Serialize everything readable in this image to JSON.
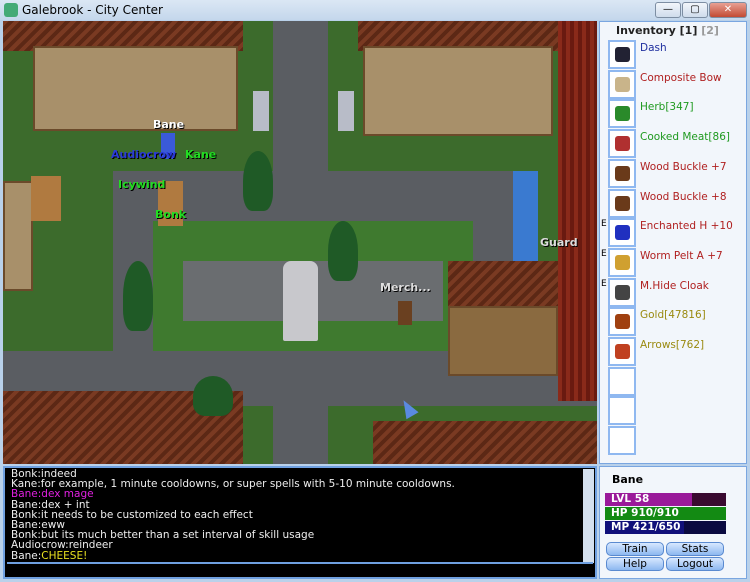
{
  "window": {
    "title": "Galebrook - City Center",
    "minimize": "—",
    "maximize": "▢",
    "close": "✕"
  },
  "map_names": [
    {
      "text": "Bane",
      "color": "#ffffff"
    },
    {
      "text": "Audiocrow",
      "color": "#2a3ad8"
    },
    {
      "text": "Kane",
      "color": "#22dd22"
    },
    {
      "text": "Icywind",
      "color": "#22dd22"
    },
    {
      "text": "Bonk",
      "color": "#22dd22"
    },
    {
      "text": "Merch...",
      "color": "#dddddd"
    },
    {
      "text": "Guard",
      "color": "#dddddd"
    }
  ],
  "inventory": {
    "title": "Inventory",
    "tab1": "[1]",
    "tab2": "[2]",
    "items": [
      {
        "name": "Dash",
        "color": "#1f2f9f",
        "icon": "book-icon",
        "equipped": ""
      },
      {
        "name": "Composite Bow",
        "color": "#b02020",
        "icon": "bow-icon",
        "equipped": ""
      },
      {
        "name": "Herb[347]",
        "color": "#1f9a1f",
        "icon": "herb-icon",
        "equipped": ""
      },
      {
        "name": "Cooked Meat[86]",
        "color": "#1f9a1f",
        "icon": "meat-icon",
        "equipped": ""
      },
      {
        "name": "Wood Buckle +7",
        "color": "#b02020",
        "icon": "shield-icon",
        "equipped": ""
      },
      {
        "name": "Wood Buckle +8",
        "color": "#b02020",
        "icon": "shield-icon",
        "equipped": ""
      },
      {
        "name": "Enchanted H +10",
        "color": "#b02020",
        "icon": "wizard-hat-icon",
        "equipped": "E"
      },
      {
        "name": "Worm Pelt A +7",
        "color": "#b02020",
        "icon": "armor-icon",
        "equipped": "E"
      },
      {
        "name": "M.Hide Cloak",
        "color": "#b02020",
        "icon": "cloak-icon",
        "equipped": "E"
      },
      {
        "name": "Gold[47816]",
        "color": "#9a8a10",
        "icon": "gold-bag-icon",
        "equipped": ""
      },
      {
        "name": "Arrows[762]",
        "color": "#9a8a10",
        "icon": "arrows-icon",
        "equipped": ""
      },
      {
        "name": "",
        "color": "",
        "icon": "",
        "equipped": ""
      },
      {
        "name": "",
        "color": "",
        "icon": "",
        "equipped": ""
      },
      {
        "name": "",
        "color": "",
        "icon": "",
        "equipped": ""
      }
    ]
  },
  "chat": {
    "lines": [
      {
        "speaker": "Bonk:",
        "text": "indeed",
        "color": "#eeeeee",
        "text_color": "#eeeeee"
      },
      {
        "speaker": "Kane:",
        "text": "for example, 1 minute cooldowns, or super spells with 5-10 minute cooldowns.",
        "color": "#eeeeee",
        "text_color": "#eeeeee"
      },
      {
        "speaker": "Bane:",
        "text": "dex mage",
        "color": "#e020e0",
        "text_color": "#e020e0"
      },
      {
        "speaker": "Bane:",
        "text": "dex + int",
        "color": "#eeeeee",
        "text_color": "#eeeeee"
      },
      {
        "speaker": "Bonk:",
        "text": "it needs to be customized to each effect",
        "color": "#eeeeee",
        "text_color": "#eeeeee"
      },
      {
        "speaker": "Bane:",
        "text": "eww",
        "color": "#eeeeee",
        "text_color": "#eeeeee"
      },
      {
        "speaker": "Bonk:",
        "text": "but its much better than a set interval of skill usage",
        "color": "#eeeeee",
        "text_color": "#eeeeee"
      },
      {
        "speaker": "Audiocrow:",
        "text": "reindeer",
        "color": "#eeeeee",
        "text_color": "#eeeeee"
      },
      {
        "speaker": "Bane:",
        "text": "CHEESE!",
        "color": "#eeeeee",
        "text_color": "#e8e020"
      }
    ],
    "input_value": ""
  },
  "player": {
    "name": "Bane",
    "level": {
      "label": "LVL 58",
      "progress": 0.72,
      "color": "#9a1a9a",
      "bg": "#3a0a30"
    },
    "hp": {
      "label": "HP 910/910",
      "progress": 1.0,
      "color": "#138a13"
    },
    "mp": {
      "label": "MP 421/650",
      "progress": 0.65,
      "color": "#10107a"
    }
  },
  "buttons": {
    "train": "Train",
    "stats": "Stats",
    "help": "Help",
    "logout": "Logout"
  }
}
